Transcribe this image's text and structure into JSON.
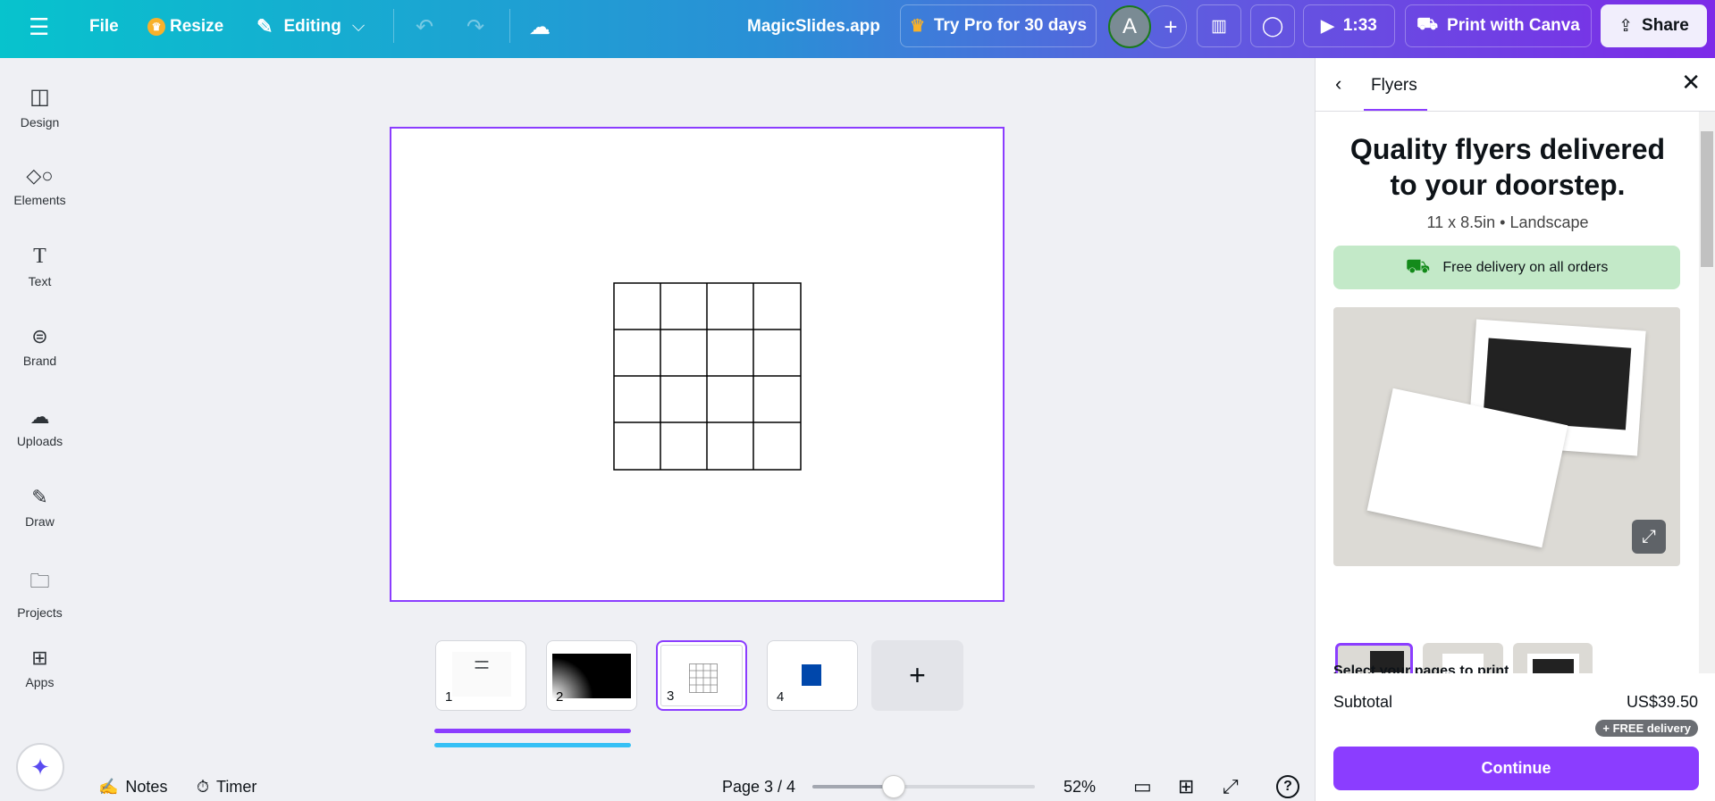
{
  "topbar": {
    "file": "File",
    "resize": "Resize",
    "editing": "Editing",
    "title": "MagicSlides.app",
    "try_pro": "Try Pro for 30 days",
    "avatar_initial": "A",
    "timer": "1:33",
    "print": "Print with Canva",
    "share": "Share"
  },
  "sidebar": {
    "items": [
      {
        "label": "Design",
        "icon": "design-icon"
      },
      {
        "label": "Elements",
        "icon": "elements-icon"
      },
      {
        "label": "Text",
        "icon": "text-icon"
      },
      {
        "label": "Brand",
        "icon": "brand-icon"
      },
      {
        "label": "Uploads",
        "icon": "uploads-icon"
      },
      {
        "label": "Draw",
        "icon": "draw-icon"
      },
      {
        "label": "Projects",
        "icon": "folder-icon"
      },
      {
        "label": "Apps",
        "icon": "apps-icon"
      }
    ]
  },
  "pages": {
    "thumbs": [
      {
        "num": "1"
      },
      {
        "num": "2"
      },
      {
        "num": "3"
      },
      {
        "num": "4"
      }
    ]
  },
  "bottombar": {
    "notes": "Notes",
    "timer": "Timer",
    "page": "Page 3 / 4",
    "zoom": "52%",
    "zoom_value": 52
  },
  "panel": {
    "tab": "Flyers",
    "heading_line1": "Quality flyers delivered",
    "heading_line2": "to your doorstep.",
    "subtitle": "11 x 8.5in • Landscape",
    "delivery_banner": "Free delivery on all orders",
    "select_pages": "Select your pages to print",
    "subtotal_label": "Subtotal",
    "subtotal_value": "US$39.50",
    "free_delivery_badge": "+ FREE delivery",
    "continue": "Continue"
  },
  "colors": {
    "accent": "#8b3dff",
    "banner": "#c3e9c8",
    "progress_purple": "#8b3dff",
    "progress_blue": "#35c0f5"
  }
}
